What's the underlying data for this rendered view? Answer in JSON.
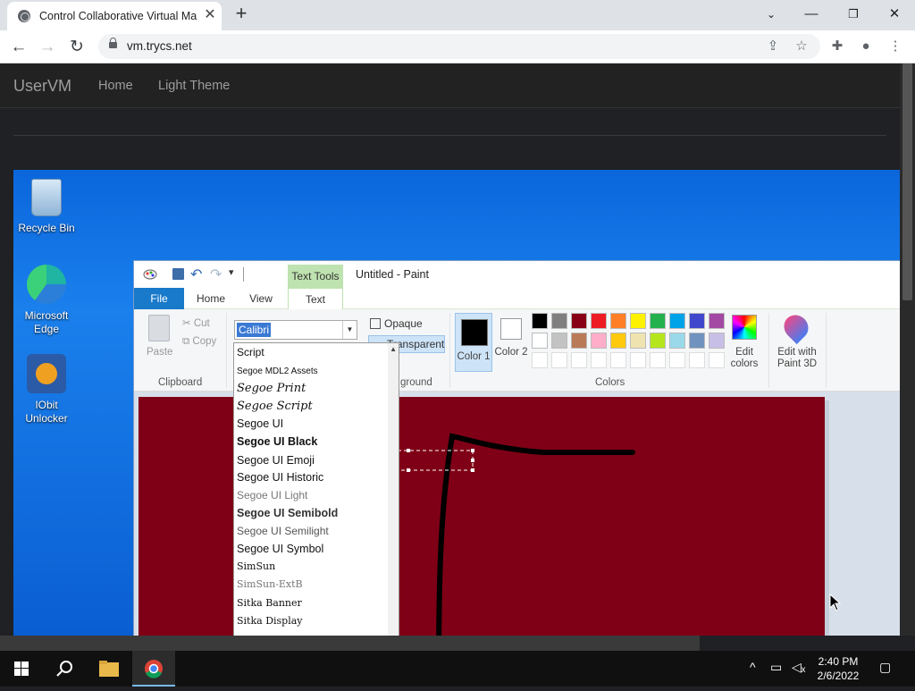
{
  "browser": {
    "tab_title": "Control Collaborative Virtual Ma",
    "url": "vm.trycs.net"
  },
  "site": {
    "brand": "UserVM",
    "nav": [
      "Home",
      "Light Theme"
    ]
  },
  "desktop": {
    "icons": [
      {
        "label": "Recycle Bin"
      },
      {
        "label": "Microsoft Edge"
      },
      {
        "label": "IObit Unlocker"
      }
    ]
  },
  "paint": {
    "window_title": "Untitled - Paint",
    "contextual_tab": "Text Tools",
    "tabs": [
      "File",
      "Home",
      "View",
      "Text"
    ],
    "clipboard": {
      "paste": "Paste",
      "cut": "Cut",
      "copy": "Copy",
      "group": "Clipboard"
    },
    "font_value": "Calibri",
    "background": {
      "opaque": "Opaque",
      "transparent": "Transparent",
      "group": "ground"
    },
    "colors": {
      "color1": "Color 1",
      "color2": "Color 2",
      "group": "Colors",
      "edit_colors": "Edit colors",
      "paint3d": "Edit with Paint 3D",
      "color1_value": "#000000",
      "color2_value": "#ffffff",
      "palette_row1": [
        "#000000",
        "#7f7f7f",
        "#880015",
        "#ed1c24",
        "#ff7f27",
        "#fff200",
        "#22b14c",
        "#00a2e8",
        "#3f48cc",
        "#a349a4"
      ],
      "palette_row2": [
        "#ffffff",
        "#c3c3c3",
        "#b97a57",
        "#ffaec9",
        "#ffc90e",
        "#efe4b0",
        "#b5e61d",
        "#99d9ea",
        "#7092be",
        "#c8bfe7"
      ]
    },
    "canvas_color": "#7f0016",
    "font_list": [
      "Script",
      "Segoe MDL2 Assets",
      "Segoe Print",
      "Segoe Script",
      "Segoe UI",
      "Segoe UI Black",
      "Segoe UI Emoji",
      "Segoe UI Historic",
      "Segoe UI Light",
      "Segoe UI Semibold",
      "Segoe UI Semilight",
      "Segoe UI Symbol",
      "SimSun",
      "SimSun-ExtB",
      "Sitka Banner",
      "Sitka Display"
    ]
  },
  "taskbar": {
    "time": "2:40 PM",
    "date": "2/6/2022"
  }
}
